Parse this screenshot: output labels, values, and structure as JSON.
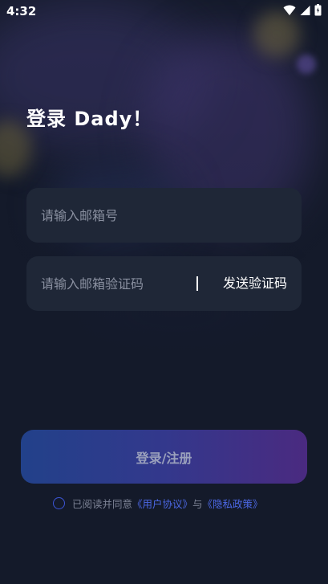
{
  "status_bar": {
    "time": "4:32",
    "icons": [
      "wifi-icon",
      "signal-icon",
      "battery-icon"
    ]
  },
  "login": {
    "title": "登录 Dady！",
    "email_placeholder": "请输入邮箱号",
    "email_value": "",
    "code_placeholder": "请输入邮箱验证码",
    "code_value": "",
    "send_code_label": "发送验证码",
    "submit_label": "登录/注册"
  },
  "agreement": {
    "checked": false,
    "prefix": "已阅读并同意",
    "user_agreement": "《用户协议》",
    "conjunction": "与",
    "privacy_policy": "《隐私政策》"
  },
  "colors": {
    "background": "#141a2a",
    "field": "#1f2737",
    "link": "#4c68e6",
    "button_gradient_start": "#22418a",
    "button_gradient_end": "#4a2a80"
  }
}
